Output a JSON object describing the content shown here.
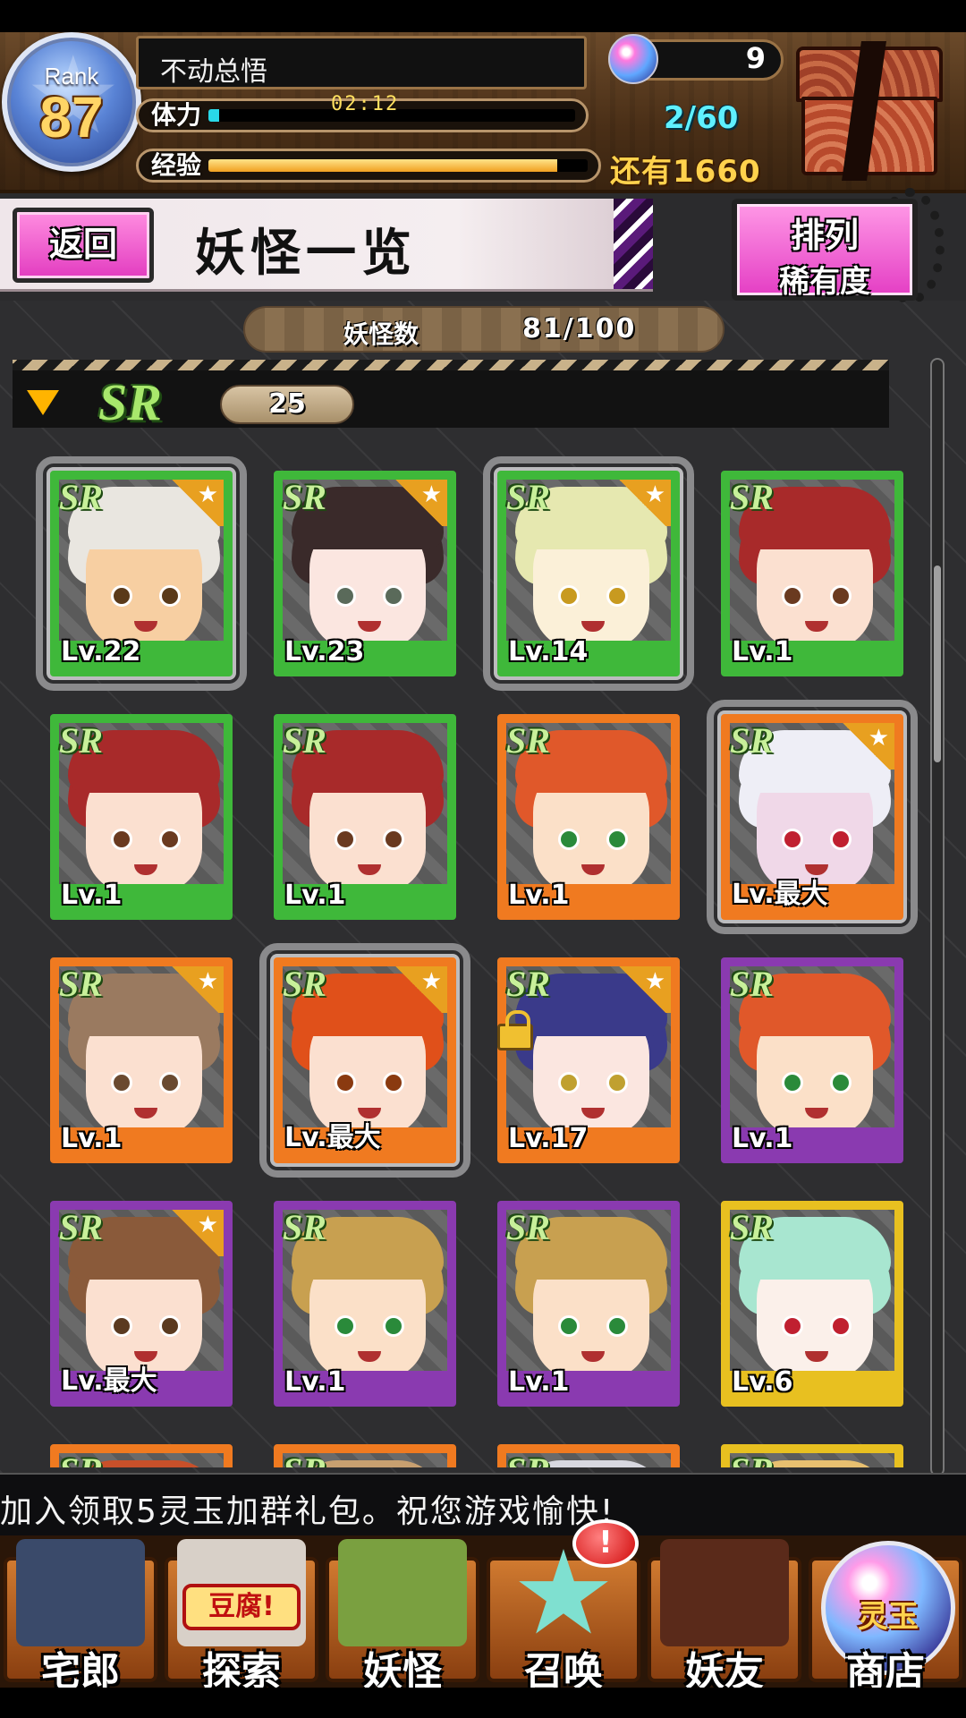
{
  "player": {
    "rank_label": "Rank",
    "rank": "87",
    "name": "不动总悟",
    "stamina_label": "体力",
    "stamina_timer": "02:12",
    "stamina_count": "2/60",
    "stamina_fraction": 0.03,
    "exp_label": "经验",
    "exp_remaining": "还有1660",
    "exp_fraction": 0.92,
    "gems": "9"
  },
  "header": {
    "back_label": "返回",
    "title": "妖怪一览",
    "sort_line1": "排列",
    "sort_line2": "稀有度"
  },
  "count": {
    "label": "妖怪数",
    "value": "81/100"
  },
  "section": {
    "rarity": "SR",
    "count": "25"
  },
  "cards": [
    {
      "rarity": "SR",
      "level": "Lv.22",
      "frame": "green",
      "selected": true,
      "starred": true,
      "skin": "#f7cfa2",
      "hair": "#e9e6e0",
      "eye": "#5a3a1a"
    },
    {
      "rarity": "SR",
      "level": "Lv.23",
      "frame": "green",
      "selected": false,
      "starred": true,
      "skin": "#fbe6e0",
      "hair": "#3a2a2a",
      "eye": "#5a6a5a"
    },
    {
      "rarity": "SR",
      "level": "Lv.14",
      "frame": "green",
      "selected": true,
      "starred": true,
      "skin": "#fbf0d8",
      "hair": "#e6e8b0",
      "eye": "#c89a20"
    },
    {
      "rarity": "SR",
      "level": "Lv.1",
      "frame": "green",
      "selected": false,
      "starred": false,
      "skin": "#fbe0d0",
      "hair": "#a82a2a",
      "eye": "#6a3a20"
    },
    {
      "rarity": "SR",
      "level": "Lv.1",
      "frame": "green",
      "selected": false,
      "starred": false,
      "skin": "#fbe0d0",
      "hair": "#a82a2a",
      "eye": "#6a3a20"
    },
    {
      "rarity": "SR",
      "level": "Lv.1",
      "frame": "green",
      "selected": false,
      "starred": false,
      "skin": "#fbe0d0",
      "hair": "#a82a2a",
      "eye": "#6a3a20"
    },
    {
      "rarity": "SR",
      "level": "Lv.1",
      "frame": "orange",
      "selected": false,
      "starred": false,
      "skin": "#fbe0c8",
      "hair": "#e0582a",
      "eye": "#2a8a3a"
    },
    {
      "rarity": "SR",
      "level": "Lv.最大",
      "frame": "orange",
      "selected": true,
      "starred": true,
      "skin": "#f0d8e8",
      "hair": "#eeeef6",
      "eye": "#c02030"
    },
    {
      "rarity": "SR",
      "level": "Lv.1",
      "frame": "orange",
      "selected": false,
      "starred": true,
      "skin": "#fbe0d0",
      "hair": "#9a7a60",
      "eye": "#6a4a30"
    },
    {
      "rarity": "SR",
      "level": "Lv.最大",
      "frame": "orange",
      "selected": true,
      "starred": true,
      "skin": "#fbe0d0",
      "hair": "#e0501a",
      "eye": "#8a3a10"
    },
    {
      "rarity": "SR",
      "level": "Lv.17",
      "frame": "orange",
      "selected": false,
      "starred": true,
      "locked": true,
      "skin": "#fbe6e0",
      "hair": "#3a3a8a",
      "eye": "#c0a030"
    },
    {
      "rarity": "SR",
      "level": "Lv.1",
      "frame": "purple",
      "selected": false,
      "starred": false,
      "skin": "#fbe0c8",
      "hair": "#e0582a",
      "eye": "#2a8a3a"
    },
    {
      "rarity": "SR",
      "level": "Lv.最大",
      "frame": "purple",
      "selected": false,
      "starred": true,
      "skin": "#fbe0d0",
      "hair": "#8a5a3a",
      "eye": "#5a3a20"
    },
    {
      "rarity": "SR",
      "level": "Lv.1",
      "frame": "purple",
      "selected": false,
      "starred": false,
      "skin": "#fbe0c8",
      "hair": "#c8a050",
      "eye": "#2a8a3a"
    },
    {
      "rarity": "SR",
      "level": "Lv.1",
      "frame": "purple",
      "selected": false,
      "starred": false,
      "skin": "#fbe0c8",
      "hair": "#c8a050",
      "eye": "#2a8a3a"
    },
    {
      "rarity": "SR",
      "level": "Lv.6",
      "frame": "yellow",
      "selected": false,
      "starred": false,
      "skin": "#fbf0ea",
      "hair": "#a8e6d0",
      "eye": "#c02030"
    },
    {
      "rarity": "SR",
      "level": "",
      "frame": "orange",
      "selected": false,
      "starred": false,
      "skin": "#fbe0c8",
      "hair": "#c8502a",
      "eye": "#6a3a20"
    },
    {
      "rarity": "SR",
      "level": "",
      "frame": "orange",
      "selected": false,
      "starred": false,
      "skin": "#fbe0c8",
      "hair": "#c8a070",
      "eye": "#6a3a20"
    },
    {
      "rarity": "SR",
      "level": "",
      "frame": "orange",
      "selected": false,
      "starred": false,
      "skin": "#fbe0c8",
      "hair": "#d8d8e0",
      "eye": "#6a3a20"
    },
    {
      "rarity": "SR",
      "level": "",
      "frame": "yellow",
      "selected": false,
      "starred": false,
      "skin": "#fbe0c8",
      "hair": "#e8c070",
      "eye": "#6a3a20"
    }
  ],
  "frame_colors": {
    "green": "#3fb83a",
    "orange": "#f07a20",
    "purple": "#8a3ab0",
    "yellow": "#e8c020"
  },
  "ticker": "加入领取5灵玉加群礼包。祝您游戏愉快!",
  "nav": [
    {
      "label": "宅郎",
      "icon": "house-icon"
    },
    {
      "label": "探索",
      "icon": "tofu-icon",
      "sub": "豆腐!"
    },
    {
      "label": "妖怪",
      "icon": "scroll-icon"
    },
    {
      "label": "召唤",
      "icon": "pentagram-icon",
      "badge": "!"
    },
    {
      "label": "妖友",
      "icon": "catgirl-icon"
    },
    {
      "label": "商店",
      "icon": "orb-icon",
      "sub": "灵玉"
    }
  ]
}
